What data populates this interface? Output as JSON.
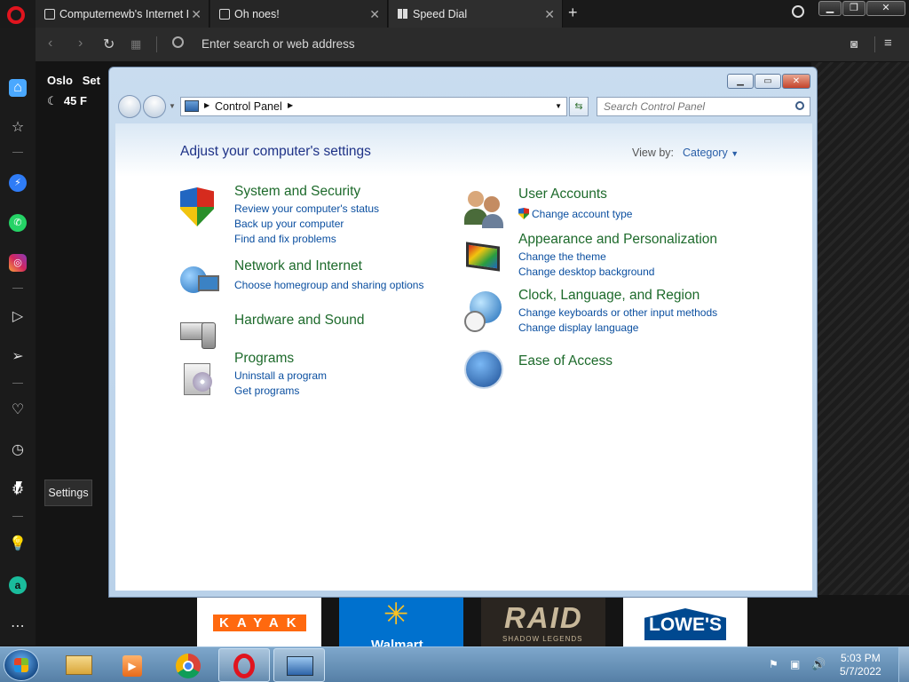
{
  "browser": {
    "tabs": [
      {
        "label": "Computernewb's Internet F"
      },
      {
        "label": "Oh noes!"
      },
      {
        "label": "Speed Dial"
      }
    ],
    "address_placeholder": "Enter search or web address",
    "weather": {
      "city": "Oslo",
      "set_label": "Set",
      "temperature": "45 F"
    },
    "sidebar_tooltip": "Settings",
    "speed_dial_tiles": [
      "KAYAK",
      "Walmart",
      "RAID",
      "LOWE'S"
    ],
    "raid_subtitle": "SHADOW LEGENDS"
  },
  "control_panel": {
    "breadcrumb": "Control Panel",
    "search_placeholder": "Search Control Panel",
    "heading": "Adjust your computer's settings",
    "view_by_label": "View by:",
    "view_by_value": "Category",
    "left_categories": [
      {
        "title": "System and Security",
        "links": [
          "Review your computer's status",
          "Back up your computer",
          "Find and fix problems"
        ]
      },
      {
        "title": "Network and Internet",
        "links": [
          "Choose homegroup and sharing options"
        ]
      },
      {
        "title": "Hardware and Sound",
        "links": []
      },
      {
        "title": "Programs",
        "links": [
          "Uninstall a program",
          "Get programs"
        ]
      }
    ],
    "right_categories": [
      {
        "title": "User Accounts",
        "links": [
          "Change account type"
        ]
      },
      {
        "title": "Appearance and Personalization",
        "links": [
          "Change the theme",
          "Change desktop background"
        ]
      },
      {
        "title": "Clock, Language, and Region",
        "links": [
          "Change keyboards or other input methods",
          "Change display language"
        ]
      },
      {
        "title": "Ease of Access",
        "links": []
      }
    ]
  },
  "taskbar": {
    "time": "5:03 PM",
    "date": "5/7/2022"
  },
  "colors": {
    "cp_link": "#0b4fa0",
    "cp_title": "#1d6a2b",
    "cp_heading": "#1e3287",
    "opera_red": "#e0141e"
  }
}
